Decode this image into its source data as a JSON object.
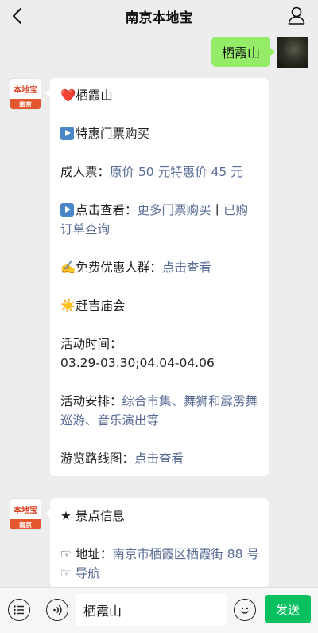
{
  "header": {
    "title": "南京本地宝"
  },
  "user_message": {
    "text": "栖霞山"
  },
  "bot_avatar": {
    "logo_text": "本地宝",
    "city": "南京"
  },
  "message1": {
    "heading": "❤️栖霞山",
    "ticket_title": "特惠门票购买",
    "adult_label": "成人票：",
    "adult_price": "原价 50 元特惠价 45 元",
    "click_view_label": "点击查看：",
    "more_tickets_link": "更多门票购买",
    "separator": "丨",
    "order_query_link": "已购订单查询",
    "free_label": "✍️免费优惠人群：",
    "free_link": "点击查看",
    "temple_fair": "赶吉庙会",
    "activity_time_label": "活动时间：",
    "activity_time_value": "03.29-03.30;04.04-04.06",
    "activity_arrange_label": "活动安排：",
    "activity_arrange_value": "综合市集、舞狮和霹雳舞巡游、音乐演出等",
    "route_label": "游览路线图：",
    "route_link": "点击查看"
  },
  "message2": {
    "heading": "★ 景点信息",
    "address_label": "☞ 地址：",
    "address_value": "南京市栖霞区栖霞街 88 号",
    "nav_link": "☞ 导航"
  },
  "input_bar": {
    "input_value": "栖霞山",
    "send_label": "发送"
  }
}
